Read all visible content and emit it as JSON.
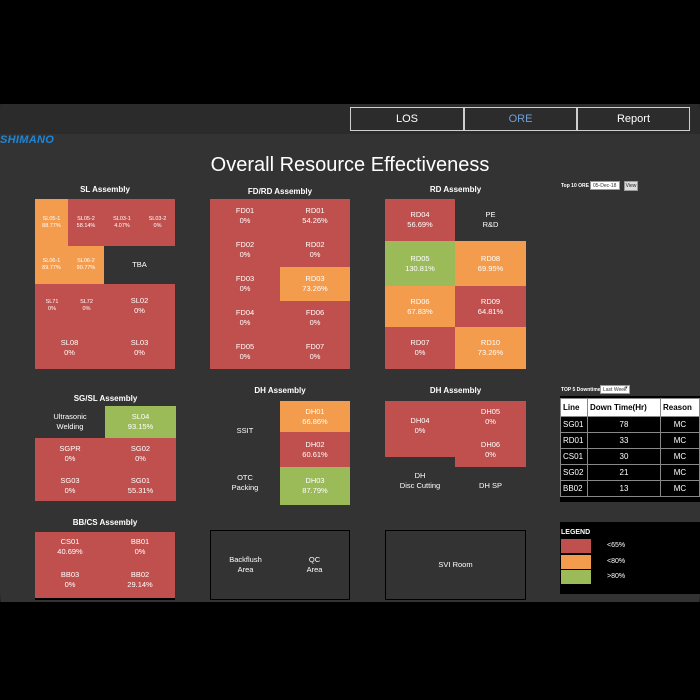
{
  "nav": {
    "tabs": [
      {
        "label": "LOS"
      },
      {
        "label": "ORE"
      },
      {
        "label": "Report"
      }
    ]
  },
  "logo": "SHIMANO",
  "page_title": "Overall Resource Effectiveness",
  "sections": {
    "sl": {
      "title": "SL Assembly",
      "tiles": [
        {
          "name": "SL05-1",
          "value": "88.77%"
        },
        {
          "name": "SL05-2",
          "value": "58.14%"
        },
        {
          "name": "SL03-1",
          "value": "4.07%"
        },
        {
          "name": "SL03-2",
          "value": "0%"
        },
        {
          "name": "SL06-1",
          "value": "89.77%"
        },
        {
          "name": "SL06-2",
          "value": "90.77%"
        },
        {
          "name": "TBA",
          "value": ""
        },
        {
          "name": "SL71",
          "value": "0%"
        },
        {
          "name": "SL72",
          "value": "0%"
        },
        {
          "name": "SL02",
          "value": "0%"
        },
        {
          "name": "SL08",
          "value": "0%"
        },
        {
          "name": "SL03",
          "value": "0%"
        }
      ]
    },
    "fdrd": {
      "title": "FD/RD Assembly",
      "tiles": [
        {
          "name": "FD01",
          "value": "0%"
        },
        {
          "name": "RD01",
          "value": "54.26%"
        },
        {
          "name": "FD02",
          "value": "0%"
        },
        {
          "name": "RD02",
          "value": "0%"
        },
        {
          "name": "FD03",
          "value": "0%"
        },
        {
          "name": "RD03",
          "value": "73.26%"
        },
        {
          "name": "FD04",
          "value": "0%"
        },
        {
          "name": "FD06",
          "value": "0%"
        },
        {
          "name": "FD05",
          "value": "0%"
        },
        {
          "name": "FD07",
          "value": "0%"
        }
      ]
    },
    "rd": {
      "title": "RD Assembly",
      "tiles": [
        {
          "name": "RD04",
          "value": "56.69%"
        },
        {
          "name": "PE",
          "value": "R&D"
        },
        {
          "name": "RD05",
          "value": "130.81%"
        },
        {
          "name": "RD08",
          "value": "69.95%"
        },
        {
          "name": "RD06",
          "value": "67.83%"
        },
        {
          "name": "RD09",
          "value": "64.81%"
        },
        {
          "name": "RD07",
          "value": "0%"
        },
        {
          "name": "RD10",
          "value": "73.26%"
        }
      ]
    },
    "sgsl": {
      "title": "SG/SL Assembly",
      "tiles": [
        {
          "name": "Ultrasonic",
          "value": "Welding"
        },
        {
          "name": "SL04",
          "value": "93.15%"
        },
        {
          "name": "SGPR",
          "value": "0%"
        },
        {
          "name": "SG02",
          "value": "0%"
        },
        {
          "name": "SG03",
          "value": "0%"
        },
        {
          "name": "SG01",
          "value": "55.31%"
        }
      ]
    },
    "dh1": {
      "title": "DH Assembly",
      "tiles": [
        {
          "name": "SSIT",
          "value": ""
        },
        {
          "name": "DH01",
          "value": "66.86%"
        },
        {
          "name": "DH02",
          "value": "60.61%"
        },
        {
          "name": "OTC",
          "value": "Packing"
        },
        {
          "name": "DH03",
          "value": "87.79%"
        }
      ]
    },
    "dh2": {
      "title": "DH Assembly",
      "tiles": [
        {
          "name": "DH04",
          "value": "0%"
        },
        {
          "name": "DH05",
          "value": "0%"
        },
        {
          "name": "DH06",
          "value": "0%"
        },
        {
          "name": "DH",
          "value": "Disc Cutting"
        },
        {
          "name": "DH SP",
          "value": ""
        }
      ]
    },
    "bbcs": {
      "title": "BB/CS Assembly",
      "tiles": [
        {
          "name": "CS01",
          "value": "40.69%"
        },
        {
          "name": "BB01",
          "value": "0%"
        },
        {
          "name": "BB03",
          "value": "0%"
        },
        {
          "name": "BB02",
          "value": "29.14%"
        }
      ]
    },
    "backflush": {
      "tiles": [
        {
          "name": "Backflush",
          "value": "Area"
        },
        {
          "name": "QC",
          "value": "Area"
        }
      ]
    },
    "svi": {
      "tiles": [
        {
          "name": "SVI Room",
          "value": ""
        }
      ]
    }
  },
  "top10": {
    "label": "Top 10 ORE :",
    "date_value": "05-Dec-18",
    "view_label": "View"
  },
  "downtime": {
    "label": "TOP 5 Downtime :",
    "select_value": "Last Week",
    "headers": [
      "Line",
      "Down Time(Hr)",
      "Reason"
    ],
    "rows": [
      [
        "SG01",
        "78",
        "MC"
      ],
      [
        "RD01",
        "33",
        "MC"
      ],
      [
        "CS01",
        "30",
        "MC"
      ],
      [
        "SG02",
        "21",
        "MC"
      ],
      [
        "BB02",
        "13",
        "MC"
      ]
    ]
  },
  "legend": {
    "title": "LEGEND",
    "items": [
      {
        "label": "<65%",
        "color": "#c0504d"
      },
      {
        "label": "<80%",
        "color": "#f39c4e"
      },
      {
        "label": ">80%",
        "color": "#9bbb59"
      }
    ]
  }
}
